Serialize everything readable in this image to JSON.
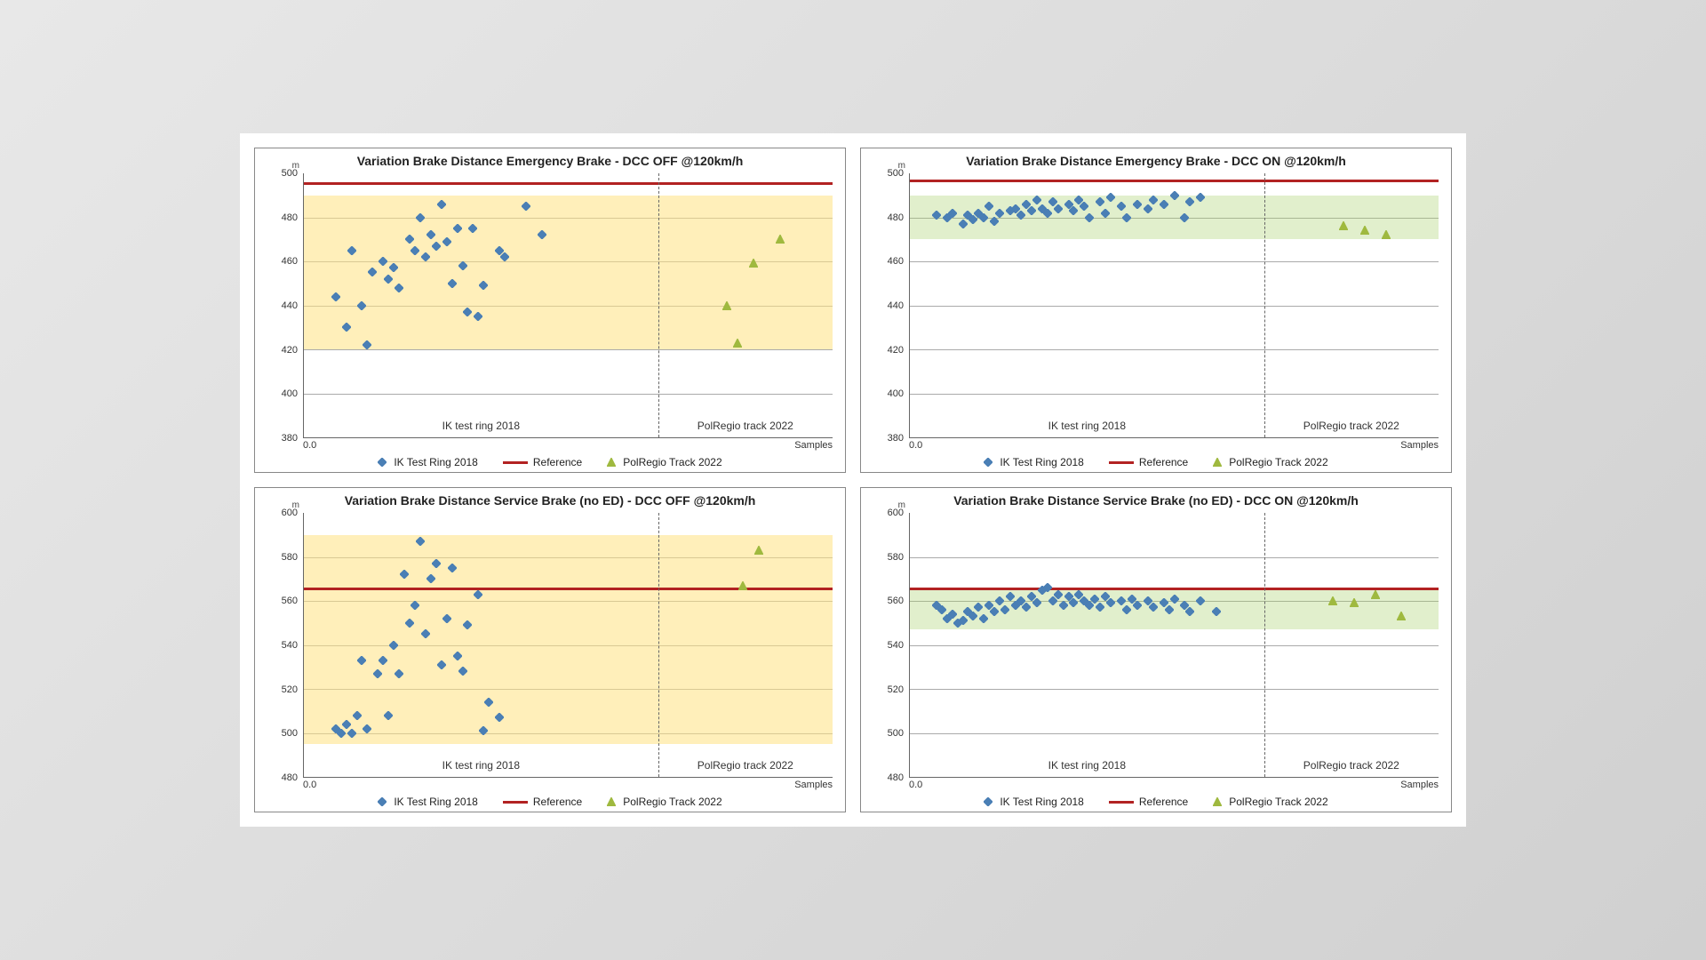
{
  "legend": {
    "series1": "IK Test Ring 2018",
    "reference": "Reference",
    "series2": "PolRegio Track 2022"
  },
  "axis": {
    "y_unit": "m",
    "x_label_left": "0.0",
    "x_label_right": "Samples"
  },
  "sections": {
    "left": "IK test ring 2018",
    "right": "PolRegio track 2022"
  },
  "colors": {
    "diamond": "#4a7fb5",
    "triangle": "#9fb93f",
    "reference": "#b22222",
    "band_off": "#ffe082",
    "band_on": "#d8e8b8"
  },
  "chart_data": [
    {
      "id": "tl",
      "title": "Variation Brake Distance Emergency Brake - DCC OFF @120km/h",
      "type": "scatter",
      "ylim": [
        380,
        500
      ],
      "ystep": 20,
      "band": {
        "color": "y",
        "from": 420,
        "to": 490
      },
      "reference": 496,
      "divider_x": 0.67,
      "series": [
        {
          "name": "IK Test Ring 2018",
          "marker": "diamond",
          "points": [
            {
              "x": 0.06,
              "y": 444
            },
            {
              "x": 0.08,
              "y": 430
            },
            {
              "x": 0.09,
              "y": 465
            },
            {
              "x": 0.11,
              "y": 440
            },
            {
              "x": 0.12,
              "y": 422
            },
            {
              "x": 0.13,
              "y": 455
            },
            {
              "x": 0.15,
              "y": 460
            },
            {
              "x": 0.16,
              "y": 452
            },
            {
              "x": 0.17,
              "y": 457
            },
            {
              "x": 0.18,
              "y": 448
            },
            {
              "x": 0.2,
              "y": 470
            },
            {
              "x": 0.21,
              "y": 465
            },
            {
              "x": 0.22,
              "y": 480
            },
            {
              "x": 0.23,
              "y": 462
            },
            {
              "x": 0.24,
              "y": 472
            },
            {
              "x": 0.25,
              "y": 467
            },
            {
              "x": 0.26,
              "y": 486
            },
            {
              "x": 0.27,
              "y": 469
            },
            {
              "x": 0.28,
              "y": 450
            },
            {
              "x": 0.29,
              "y": 475
            },
            {
              "x": 0.3,
              "y": 458
            },
            {
              "x": 0.31,
              "y": 437
            },
            {
              "x": 0.32,
              "y": 475
            },
            {
              "x": 0.33,
              "y": 435
            },
            {
              "x": 0.34,
              "y": 449
            },
            {
              "x": 0.37,
              "y": 465
            },
            {
              "x": 0.38,
              "y": 462
            },
            {
              "x": 0.42,
              "y": 485
            },
            {
              "x": 0.45,
              "y": 472
            }
          ]
        },
        {
          "name": "PolRegio Track 2022",
          "marker": "triangle",
          "points": [
            {
              "x": 0.8,
              "y": 440
            },
            {
              "x": 0.82,
              "y": 423
            },
            {
              "x": 0.85,
              "y": 459
            },
            {
              "x": 0.9,
              "y": 470
            }
          ]
        }
      ]
    },
    {
      "id": "tr",
      "title": "Variation Brake Distance Emergency Brake - DCC ON @120km/h",
      "type": "scatter",
      "ylim": [
        380,
        500
      ],
      "ystep": 20,
      "band": {
        "color": "g",
        "from": 470,
        "to": 490
      },
      "reference": 497,
      "divider_x": 0.67,
      "series": [
        {
          "name": "IK Test Ring 2018",
          "marker": "diamond",
          "points": [
            {
              "x": 0.05,
              "y": 481
            },
            {
              "x": 0.07,
              "y": 480
            },
            {
              "x": 0.08,
              "y": 482
            },
            {
              "x": 0.1,
              "y": 477
            },
            {
              "x": 0.11,
              "y": 481
            },
            {
              "x": 0.12,
              "y": 479
            },
            {
              "x": 0.13,
              "y": 482
            },
            {
              "x": 0.14,
              "y": 480
            },
            {
              "x": 0.15,
              "y": 485
            },
            {
              "x": 0.16,
              "y": 478
            },
            {
              "x": 0.17,
              "y": 482
            },
            {
              "x": 0.19,
              "y": 483
            },
            {
              "x": 0.2,
              "y": 484
            },
            {
              "x": 0.21,
              "y": 481
            },
            {
              "x": 0.22,
              "y": 486
            },
            {
              "x": 0.23,
              "y": 483
            },
            {
              "x": 0.24,
              "y": 488
            },
            {
              "x": 0.25,
              "y": 484
            },
            {
              "x": 0.26,
              "y": 482
            },
            {
              "x": 0.27,
              "y": 487
            },
            {
              "x": 0.28,
              "y": 484
            },
            {
              "x": 0.3,
              "y": 486
            },
            {
              "x": 0.31,
              "y": 483
            },
            {
              "x": 0.32,
              "y": 488
            },
            {
              "x": 0.33,
              "y": 485
            },
            {
              "x": 0.34,
              "y": 480
            },
            {
              "x": 0.36,
              "y": 487
            },
            {
              "x": 0.37,
              "y": 482
            },
            {
              "x": 0.38,
              "y": 489
            },
            {
              "x": 0.4,
              "y": 485
            },
            {
              "x": 0.41,
              "y": 480
            },
            {
              "x": 0.43,
              "y": 486
            },
            {
              "x": 0.45,
              "y": 484
            },
            {
              "x": 0.46,
              "y": 488
            },
            {
              "x": 0.48,
              "y": 486
            },
            {
              "x": 0.5,
              "y": 490
            },
            {
              "x": 0.52,
              "y": 480
            },
            {
              "x": 0.53,
              "y": 487
            },
            {
              "x": 0.55,
              "y": 489
            }
          ]
        },
        {
          "name": "PolRegio Track 2022",
          "marker": "triangle",
          "points": [
            {
              "x": 0.82,
              "y": 476
            },
            {
              "x": 0.86,
              "y": 474
            },
            {
              "x": 0.9,
              "y": 472
            }
          ]
        }
      ]
    },
    {
      "id": "bl",
      "title": "Variation Brake Distance Service Brake (no ED) - DCC OFF @120km/h",
      "type": "scatter",
      "ylim": [
        480,
        600
      ],
      "ystep": 20,
      "band": {
        "color": "y",
        "from": 495,
        "to": 590
      },
      "reference": 566,
      "divider_x": 0.67,
      "series": [
        {
          "name": "IK Test Ring 2018",
          "marker": "diamond",
          "points": [
            {
              "x": 0.06,
              "y": 502
            },
            {
              "x": 0.07,
              "y": 500
            },
            {
              "x": 0.08,
              "y": 504
            },
            {
              "x": 0.09,
              "y": 500
            },
            {
              "x": 0.1,
              "y": 508
            },
            {
              "x": 0.11,
              "y": 533
            },
            {
              "x": 0.12,
              "y": 502
            },
            {
              "x": 0.14,
              "y": 527
            },
            {
              "x": 0.15,
              "y": 533
            },
            {
              "x": 0.16,
              "y": 508
            },
            {
              "x": 0.17,
              "y": 540
            },
            {
              "x": 0.18,
              "y": 527
            },
            {
              "x": 0.19,
              "y": 572
            },
            {
              "x": 0.2,
              "y": 550
            },
            {
              "x": 0.21,
              "y": 558
            },
            {
              "x": 0.22,
              "y": 587
            },
            {
              "x": 0.23,
              "y": 545
            },
            {
              "x": 0.24,
              "y": 570
            },
            {
              "x": 0.25,
              "y": 577
            },
            {
              "x": 0.26,
              "y": 531
            },
            {
              "x": 0.27,
              "y": 552
            },
            {
              "x": 0.28,
              "y": 575
            },
            {
              "x": 0.29,
              "y": 535
            },
            {
              "x": 0.3,
              "y": 528
            },
            {
              "x": 0.31,
              "y": 549
            },
            {
              "x": 0.33,
              "y": 563
            },
            {
              "x": 0.34,
              "y": 501
            },
            {
              "x": 0.35,
              "y": 514
            },
            {
              "x": 0.37,
              "y": 507
            }
          ]
        },
        {
          "name": "PolRegio Track 2022",
          "marker": "triangle",
          "points": [
            {
              "x": 0.83,
              "y": 567
            },
            {
              "x": 0.86,
              "y": 583
            }
          ]
        }
      ]
    },
    {
      "id": "br",
      "title": "Variation Brake Distance Service Brake (no ED) - DCC ON @120km/h",
      "type": "scatter",
      "ylim": [
        480,
        600
      ],
      "ystep": 20,
      "band": {
        "color": "g",
        "from": 547,
        "to": 565
      },
      "reference": 566,
      "divider_x": 0.67,
      "series": [
        {
          "name": "IK Test Ring 2018",
          "marker": "diamond",
          "points": [
            {
              "x": 0.05,
              "y": 558
            },
            {
              "x": 0.06,
              "y": 556
            },
            {
              "x": 0.07,
              "y": 552
            },
            {
              "x": 0.08,
              "y": 554
            },
            {
              "x": 0.09,
              "y": 550
            },
            {
              "x": 0.1,
              "y": 551
            },
            {
              "x": 0.11,
              "y": 555
            },
            {
              "x": 0.12,
              "y": 553
            },
            {
              "x": 0.13,
              "y": 557
            },
            {
              "x": 0.14,
              "y": 552
            },
            {
              "x": 0.15,
              "y": 558
            },
            {
              "x": 0.16,
              "y": 555
            },
            {
              "x": 0.17,
              "y": 560
            },
            {
              "x": 0.18,
              "y": 556
            },
            {
              "x": 0.19,
              "y": 562
            },
            {
              "x": 0.2,
              "y": 558
            },
            {
              "x": 0.21,
              "y": 560
            },
            {
              "x": 0.22,
              "y": 557
            },
            {
              "x": 0.23,
              "y": 562
            },
            {
              "x": 0.24,
              "y": 559
            },
            {
              "x": 0.25,
              "y": 565
            },
            {
              "x": 0.26,
              "y": 566
            },
            {
              "x": 0.27,
              "y": 560
            },
            {
              "x": 0.28,
              "y": 563
            },
            {
              "x": 0.29,
              "y": 558
            },
            {
              "x": 0.3,
              "y": 562
            },
            {
              "x": 0.31,
              "y": 559
            },
            {
              "x": 0.32,
              "y": 563
            },
            {
              "x": 0.33,
              "y": 560
            },
            {
              "x": 0.34,
              "y": 558
            },
            {
              "x": 0.35,
              "y": 561
            },
            {
              "x": 0.36,
              "y": 557
            },
            {
              "x": 0.37,
              "y": 562
            },
            {
              "x": 0.38,
              "y": 559
            },
            {
              "x": 0.4,
              "y": 560
            },
            {
              "x": 0.41,
              "y": 556
            },
            {
              "x": 0.42,
              "y": 561
            },
            {
              "x": 0.43,
              "y": 558
            },
            {
              "x": 0.45,
              "y": 560
            },
            {
              "x": 0.46,
              "y": 557
            },
            {
              "x": 0.48,
              "y": 559
            },
            {
              "x": 0.49,
              "y": 556
            },
            {
              "x": 0.5,
              "y": 561
            },
            {
              "x": 0.52,
              "y": 558
            },
            {
              "x": 0.53,
              "y": 555
            },
            {
              "x": 0.55,
              "y": 560
            },
            {
              "x": 0.58,
              "y": 555
            }
          ]
        },
        {
          "name": "PolRegio Track 2022",
          "marker": "triangle",
          "points": [
            {
              "x": 0.8,
              "y": 560
            },
            {
              "x": 0.84,
              "y": 559
            },
            {
              "x": 0.88,
              "y": 563
            },
            {
              "x": 0.93,
              "y": 553
            }
          ]
        }
      ]
    }
  ]
}
